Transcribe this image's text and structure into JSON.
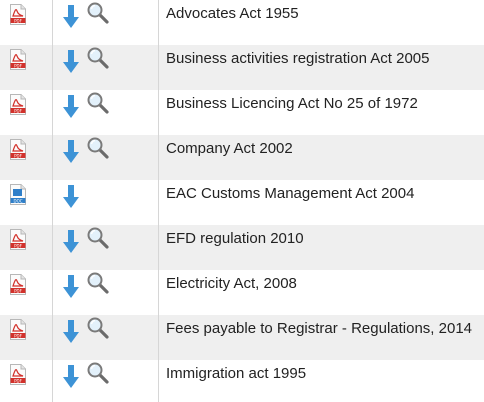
{
  "documents": [
    {
      "title": "Advocates Act 1955",
      "type": "pdf",
      "type_label": "PDF",
      "has_view": true
    },
    {
      "title": "Business activities registration Act 2005",
      "type": "pdf",
      "type_label": "PDF",
      "has_view": true
    },
    {
      "title": "Business Licencing Act No 25 of 1972",
      "type": "pdf",
      "type_label": "PDF",
      "has_view": true
    },
    {
      "title": "Company Act 2002",
      "type": "pdf",
      "type_label": "PDF",
      "has_view": true
    },
    {
      "title": "EAC Customs Management Act 2004",
      "type": "doc",
      "type_label": "DOC",
      "has_view": false
    },
    {
      "title": "EFD regulation 2010",
      "type": "pdf",
      "type_label": "PDF",
      "has_view": true
    },
    {
      "title": "Electricity Act, 2008",
      "type": "pdf",
      "type_label": "PDF",
      "has_view": true
    },
    {
      "title": "Fees payable to Registrar - Regulations, 2014",
      "type": "pdf",
      "type_label": "PDF",
      "has_view": true
    },
    {
      "title": "Immigration act 1995",
      "type": "pdf",
      "type_label": "PDF",
      "has_view": true
    }
  ],
  "colors": {
    "pdf_red": "#d2312b",
    "doc_blue": "#2f7fc9",
    "download_blue": "#3d93d6",
    "row_alt": "#efefef",
    "divider": "#d6d6d6",
    "text": "#222222"
  },
  "icons": {
    "pdf": "pdf-file-icon",
    "doc": "doc-file-icon",
    "download": "download-arrow-icon",
    "view": "magnifier-icon"
  }
}
